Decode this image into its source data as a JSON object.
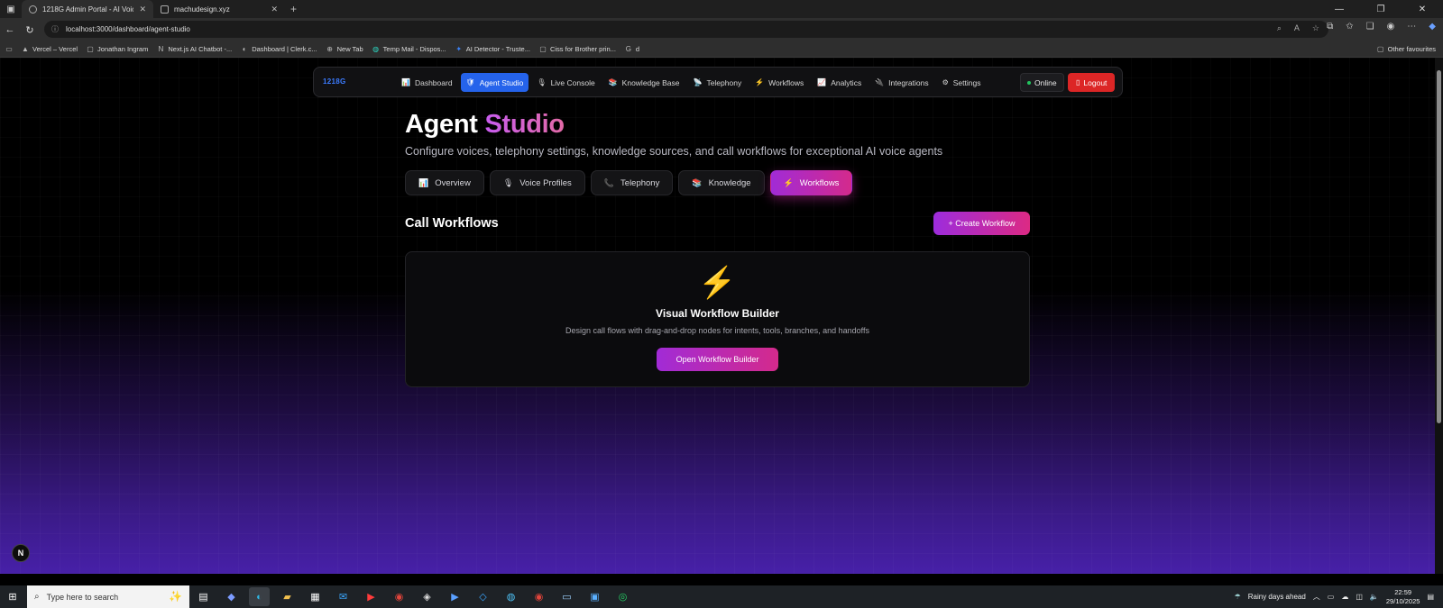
{
  "browser": {
    "tabs": [
      {
        "title": "1218G Admin Portal - AI Voice A",
        "active": true
      },
      {
        "title": "machudesign.xyz",
        "active": false
      }
    ],
    "url": "localhost:3000/dashboard/agent-studio",
    "bookmarks": [
      {
        "label": "Vercel – Vercel",
        "icon": "vercel-icon"
      },
      {
        "label": "Jonathan Ingram",
        "icon": "folder-icon"
      },
      {
        "label": "Next.js AI Chatbot -...",
        "icon": "nextjs-icon"
      },
      {
        "label": "Dashboard | Clerk.c...",
        "icon": "clerk-icon"
      },
      {
        "label": "New Tab",
        "icon": "globe-icon"
      },
      {
        "label": "Temp Mail - Dispos...",
        "icon": "tempmail-icon"
      },
      {
        "label": "AI Detector - Truste...",
        "icon": "ai-detector-icon"
      },
      {
        "label": "Ciss for Brother prin...",
        "icon": "folder-icon"
      },
      {
        "label": "d",
        "icon": "google-icon"
      }
    ],
    "other_favourites": "Other favourites"
  },
  "nav": {
    "brand": "1218G",
    "items": [
      {
        "label": "Dashboard",
        "icon": "📊",
        "active": false
      },
      {
        "label": "Agent Studio",
        "icon": "🛡",
        "active": true
      },
      {
        "label": "Live Console",
        "icon": "🎙",
        "active": false
      },
      {
        "label": "Knowledge Base",
        "icon": "📚",
        "active": false
      },
      {
        "label": "Telephony",
        "icon": "📡",
        "active": false
      },
      {
        "label": "Workflows",
        "icon": "⚡",
        "active": false
      },
      {
        "label": "Analytics",
        "icon": "📈",
        "active": false
      },
      {
        "label": "Integrations",
        "icon": "🔌",
        "active": false
      },
      {
        "label": "Settings",
        "icon": "⚙",
        "active": false
      }
    ],
    "status": "Online",
    "logout": "Logout"
  },
  "header": {
    "title_part1": "Agent",
    "title_part2": "Studio",
    "subtitle": "Configure voices, telephony settings, knowledge sources, and call workflows for exceptional AI voice agents"
  },
  "studio_tabs": [
    {
      "label": "Overview",
      "icon": "📊",
      "active": false
    },
    {
      "label": "Voice Profiles",
      "icon": "🎙",
      "active": false
    },
    {
      "label": "Telephony",
      "icon": "📞",
      "active": false
    },
    {
      "label": "Knowledge",
      "icon": "📚",
      "active": false
    },
    {
      "label": "Workflows",
      "icon": "⚡",
      "active": true
    }
  ],
  "section": {
    "title": "Call Workflows",
    "create_button": "+ Create Workflow"
  },
  "card": {
    "icon": "⚡",
    "title": "Visual Workflow Builder",
    "description": "Design call flows with drag-and-drop nodes for intents, tools, branches, and handoffs",
    "button": "Open Workflow Builder"
  },
  "nextjs_badge": "N",
  "taskbar": {
    "search_placeholder": "Type here to search",
    "weather": "Rainy days ahead",
    "time": "22:59",
    "date": "29/10/2025"
  },
  "colors": {
    "accent_blue": "#2563eb",
    "gradient_start": "#a12bd6",
    "gradient_end": "#d42a8c",
    "logout_red": "#dc2626",
    "online_green": "#22c55e"
  }
}
